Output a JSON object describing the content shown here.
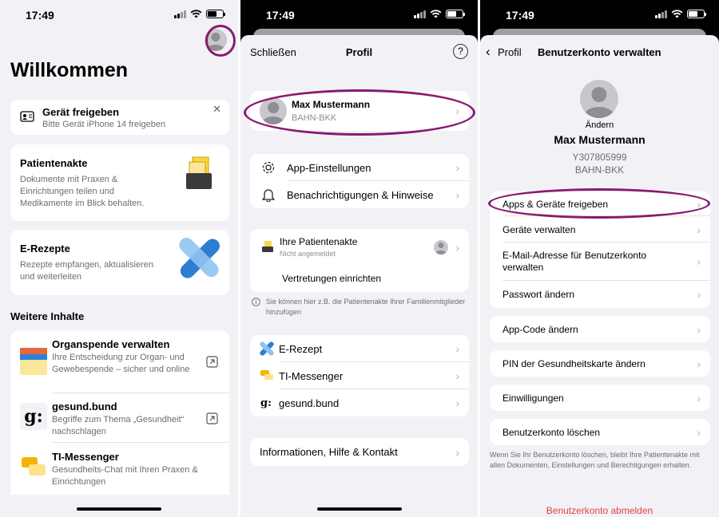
{
  "status": {
    "time": "17:49"
  },
  "screen1": {
    "title": "Willkommen",
    "share_card": {
      "title": "Gerät freigeben",
      "subtitle": "Bitte Gerät iPhone 14 freigeben",
      "close_icon": "✕"
    },
    "record_card": {
      "title": "Patientenakte",
      "subtitle": "Dokumente mit Praxen & Einrichtungen teilen und Medikamente im Blick behalten."
    },
    "erezept_card": {
      "title": "E-Rezepte",
      "subtitle": "Rezepte empfangen, aktualisieren und weiterleiten"
    },
    "more_heading": "Weitere Inhalte",
    "more_items": [
      {
        "title": "Organspende verwalten",
        "subtitle": "Ihre Entscheidung zur Organ- und Gewebespende – sicher und online"
      },
      {
        "title": "gesund.bund",
        "subtitle": "Begriffe zum Thema „Gesundheit“ nachschlagen",
        "logo": "g:"
      },
      {
        "title": "TI-Messenger",
        "subtitle": "Gesundheits-Chat mit Ihren Praxen & Einrichtungen"
      }
    ]
  },
  "screen2": {
    "close": "Schließen",
    "title": "Profil",
    "help": "?",
    "profile": {
      "name": "Max Mustermann",
      "insurer": "BAHN-BKK"
    },
    "settings": [
      {
        "label": "App-Einstellungen",
        "icon": "gear-icon"
      },
      {
        "label": "Benachrichtigungen & Hinweise",
        "icon": "bell-icon"
      }
    ],
    "record": {
      "title": "Ihre Patientenakte",
      "subtitle": "Nicht angemeldet",
      "action": "Vertretungen einrichten"
    },
    "info_note": "Sie können hier z.B. die Patientenakte Ihrer Familienmitglieder hinzufügen",
    "apps": [
      {
        "label": "E-Rezept",
        "icon": "erezept-icon"
      },
      {
        "label": "TI-Messenger",
        "icon": "messenger-icon"
      },
      {
        "label": "gesund.bund",
        "icon": "gesund-bund-icon"
      }
    ],
    "info": "Informationen, Hilfe & Kontakt"
  },
  "screen3": {
    "back": "Profil",
    "title": "Benutzerkonto verwalten",
    "change": "Ändern",
    "name": "Max Mustermann",
    "id": "Y307805999",
    "insurer": "BAHN-BKK",
    "group1": [
      "Apps & Geräte freigeben",
      "Geräte verwalten",
      "E-Mail-Adresse für Benutzerkonto verwalten",
      "Passwort ändern"
    ],
    "app_code": "App-Code ändern",
    "pin": "PIN der Gesundheitskarte ändern",
    "consents": "Einwilligungen",
    "delete": "Benutzerkonto löschen",
    "delete_note": "Wenn Sie Ihr Benutzerkonto löschen, bleibt Ihre Patientenakte mit allen Dokumenten, Einstellungen und Berechtigungen erhalten.",
    "logout": "Benutzerkonto abmelden"
  },
  "colors": {
    "highlight": "#8a1a6e",
    "accent": "#2f7fd6",
    "danger": "#e0433a"
  }
}
